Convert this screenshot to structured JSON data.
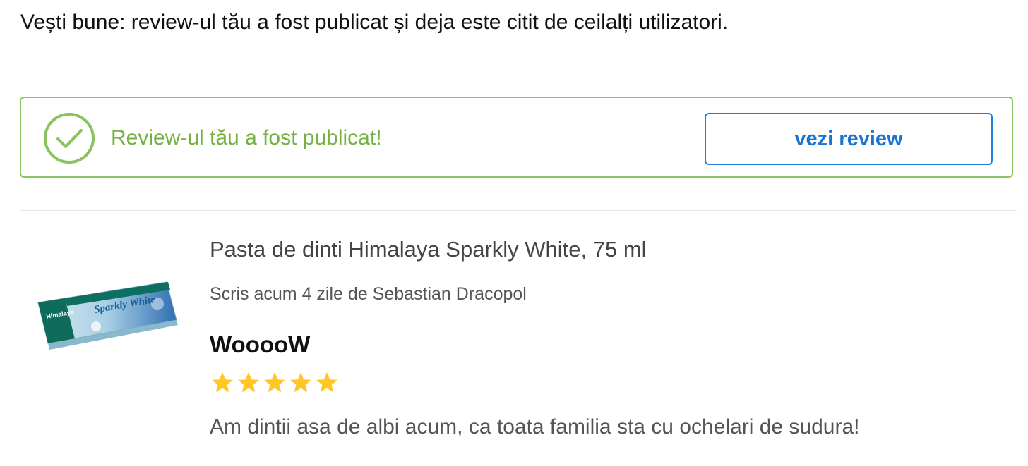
{
  "intro": {
    "text": "Vești bune: review-ul tău a fost publicat și deja este citit de ceilalți utilizatori."
  },
  "notice": {
    "icon": "check-circle-icon",
    "text": "Review-ul tău a fost publicat!",
    "button_label": "vezi review",
    "accent_color": "#75b041",
    "button_color": "#1a74d2"
  },
  "product": {
    "image_icon": "toothpaste-product-image",
    "image_brand_text": "Himalaya",
    "image_product_text": "Sparkly White",
    "title": "Pasta de dinti Himalaya Sparkly White, 75 ml"
  },
  "review": {
    "byline": "Scris acum 4 zile de Sebastian Dracopol",
    "title": "WooooW",
    "rating": 5,
    "rating_max": 5,
    "star_color": "#ffc626",
    "body": "Am dintii asa de albi acum, ca toata familia sta cu ochelari de sudura!"
  }
}
